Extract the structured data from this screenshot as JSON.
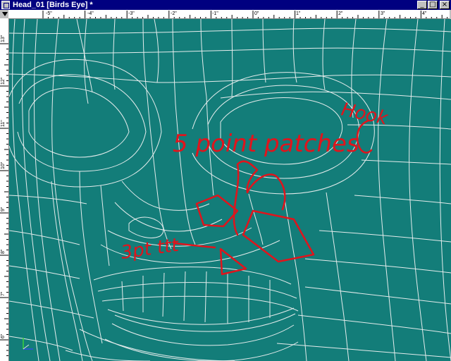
{
  "window": {
    "title": "Head_01 [Birds Eye] *",
    "min_glyph": "_",
    "max_glyph": "□",
    "close_glyph": "×"
  },
  "ruler_top": {
    "labels": [
      "-5\"",
      "-4\"",
      "-3\"",
      "-2\"",
      "-1\"",
      "0\"",
      "1\"",
      "2\"",
      "3\"",
      "4\""
    ]
  },
  "ruler_left": {
    "labels": [
      "13\"",
      "12\"",
      "11\"",
      "10\"",
      "9\"",
      "8\"",
      "7\"",
      "6\""
    ]
  },
  "annotations": {
    "five_point": "5 point patches",
    "hook": "Hook",
    "three_pt": "3pt ttt"
  },
  "colors": {
    "viewport_bg": "#137d79",
    "mesh": "#e4ecec",
    "annotation": "#e0141c",
    "titlebar": "#000080"
  },
  "icons": {
    "axis": "axis-gizmo-icon",
    "window": "window-icon"
  }
}
